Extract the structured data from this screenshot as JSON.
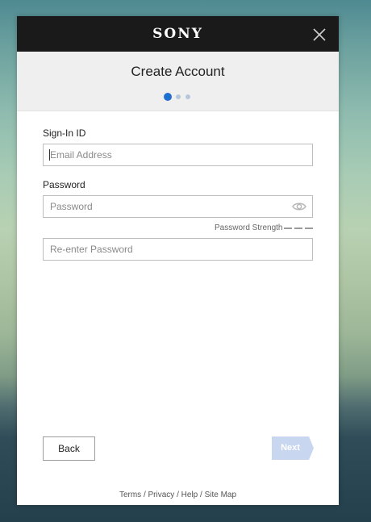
{
  "brand": {
    "logo_text": "SONY",
    "logo_color": "#ffffff",
    "bar_color": "#1a1a1a"
  },
  "header": {
    "title": "Create Account",
    "steps": {
      "current": 1,
      "total": 3,
      "active_color": "#1f6fd1",
      "inactive_color": "#b7c7da"
    }
  },
  "form": {
    "signin_label": "Sign-In ID",
    "email_placeholder": "Email Address",
    "password_label": "Password",
    "password_placeholder": "Password",
    "strength_label": "Password Strength",
    "reenter_placeholder": "Re-enter Password"
  },
  "actions": {
    "back_label": "Back",
    "next_label": "Next",
    "next_color": "#c8d6f0"
  },
  "footer": {
    "terms": "Terms",
    "privacy": "Privacy",
    "help": "Help",
    "sitemap": "Site Map",
    "separator": "/"
  },
  "icons": {
    "close": "close-icon",
    "show_password": "eye-icon"
  }
}
